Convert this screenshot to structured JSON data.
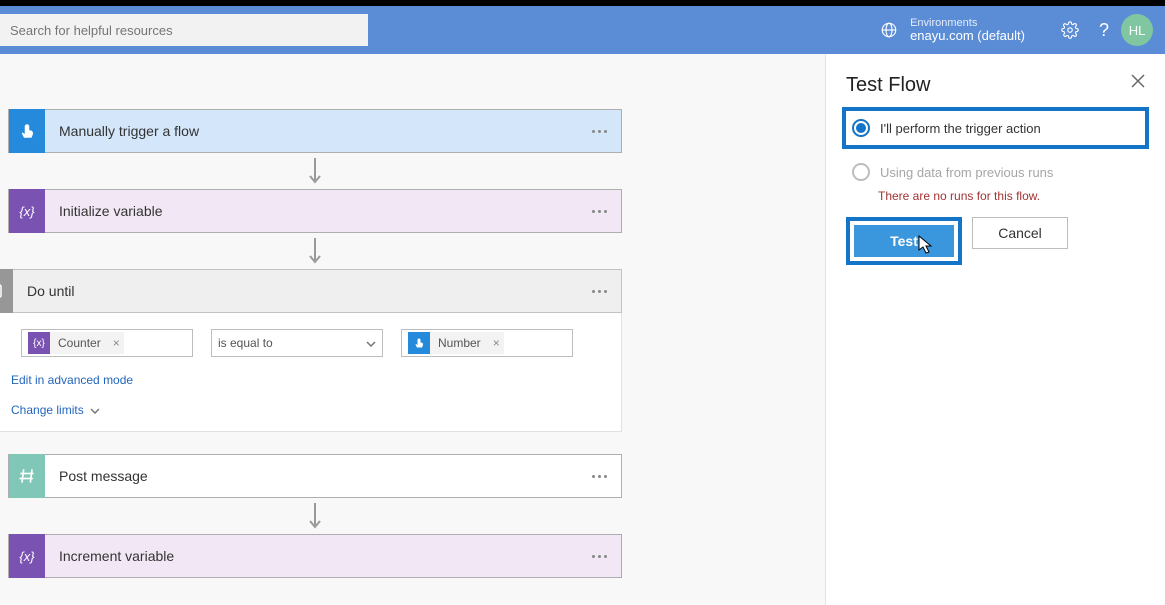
{
  "header": {
    "search_placeholder": "Search for helpful resources",
    "env_label": "Environments",
    "env_name": "enayu.com (default)",
    "avatar_initials": "HL"
  },
  "flow": {
    "trigger_label": "Manually trigger a flow",
    "init_var_label": "Initialize variable",
    "do_until_label": "Do until",
    "do_until": {
      "token1": "Counter",
      "operator": "is equal to",
      "token2": "Number",
      "advanced_link": "Edit in advanced mode",
      "limits_link": "Change limits"
    },
    "post_label": "Post message",
    "increment_label": "Increment variable"
  },
  "panel": {
    "title": "Test Flow",
    "option1": "I'll perform the trigger action",
    "option2": "Using data from previous runs",
    "no_runs": "There are no runs for this flow.",
    "test_btn": "Test",
    "cancel_btn": "Cancel"
  }
}
